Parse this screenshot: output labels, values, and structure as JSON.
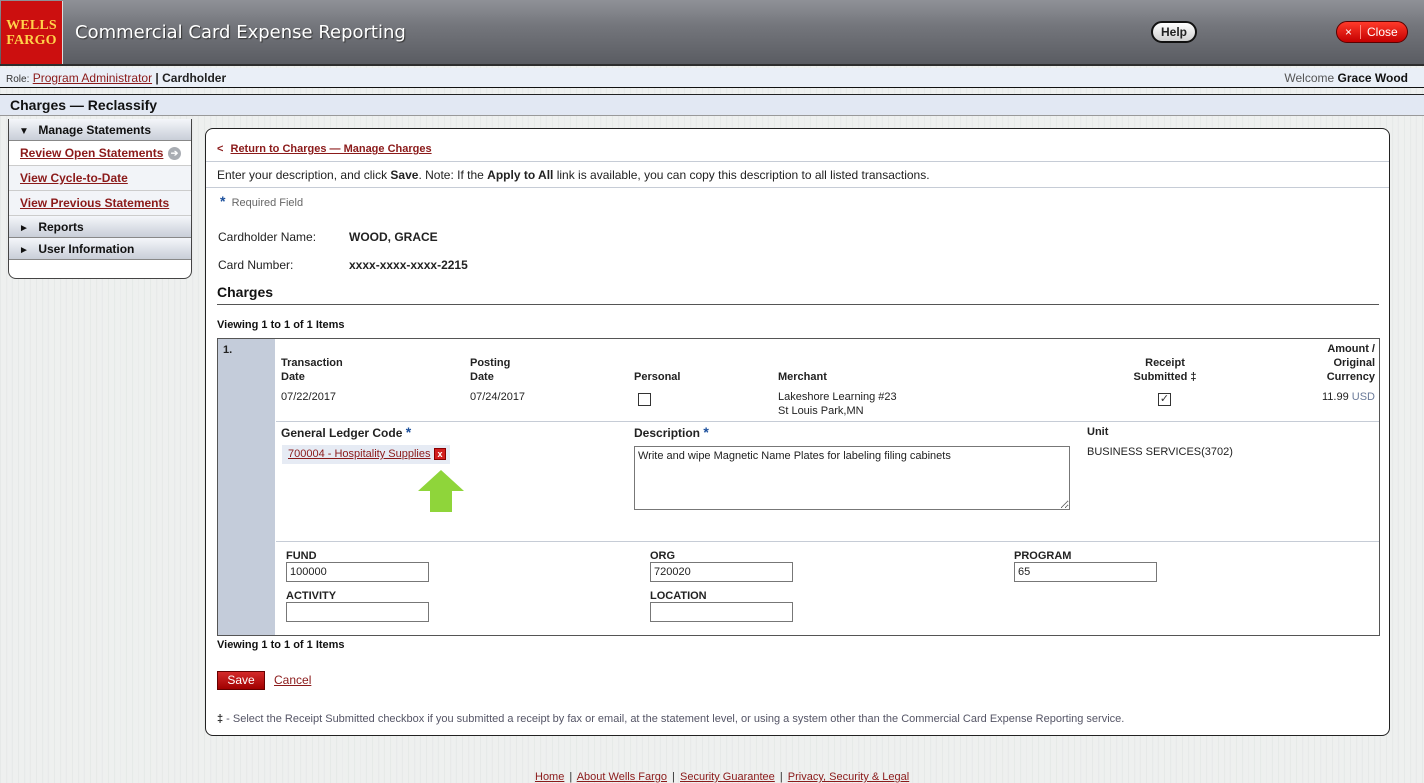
{
  "header": {
    "logo_line1": "WELLS",
    "logo_line2": "FARGO",
    "app_title": "Commercial Card Expense Reporting",
    "help_label": "Help",
    "close_icon": "×",
    "close_label": "Close"
  },
  "rolebar": {
    "role_prefix": "Role:",
    "role_link": "Program Administrator",
    "separator": "|",
    "current_role": "Cardholder",
    "welcome_prefix": "Welcome",
    "user_name": "Grace Wood"
  },
  "page_title": "Charges — Reclassify",
  "sidebar": {
    "sections": [
      {
        "arrow": "▼",
        "label": "Manage Statements"
      },
      {
        "arrow": "►",
        "label": "Reports"
      },
      {
        "arrow": "►",
        "label": "User Information"
      }
    ],
    "items": [
      {
        "label": "Review Open Statements",
        "icon": "➔"
      },
      {
        "label": "View Cycle-to-Date"
      },
      {
        "label": "View Previous Statements"
      }
    ]
  },
  "main": {
    "return_arrow": "<",
    "return_link": "Return to Charges — Manage Charges",
    "intro": {
      "part1": "Enter your description, and click ",
      "save": "Save",
      "part2": ". Note: If the ",
      "apply": "Apply to All",
      "part3": " link is available, you can copy this description to all listed transactions."
    },
    "required_star": "*",
    "required_label": "Required Field",
    "cardholder_label": "Cardholder Name:",
    "cardholder_value": "WOOD, GRACE",
    "card_number_label": "Card Number:",
    "card_number_value": "xxxx-xxxx-xxxx-2215",
    "section_title": "Charges",
    "viewing_top": "Viewing 1 to 1 of 1 Items",
    "viewing_bottom": "Viewing 1 to 1 of 1 Items",
    "charge": {
      "row_number": "1.",
      "headers": {
        "transaction_date_1": "Transaction",
        "transaction_date_2": "Date",
        "posting_date_1": "Posting",
        "posting_date_2": "Date",
        "personal": "Personal",
        "merchant": "Merchant",
        "receipt_1": "Receipt",
        "receipt_2": "Submitted ‡",
        "amount_1": "Amount /",
        "amount_2": "Original",
        "amount_3": "Currency"
      },
      "transaction_date": "07/22/2017",
      "posting_date": "07/24/2017",
      "personal_checked": false,
      "merchant_line1": "Lakeshore Learning #23",
      "merchant_line2": "St Louis Park,MN",
      "receipt_submitted": true,
      "receipt_check": "✓",
      "amount": "11.99",
      "currency": "USD",
      "gl_label": "General Ledger Code",
      "gl_value": "700004 - Hospitality Supplies",
      "gl_remove_icon": "x",
      "description_label": "Description",
      "description_value": "Write and wipe Magnetic Name Plates for labeling filing cabinets",
      "unit_label": "Unit",
      "unit_value": "BUSINESS SERVICES(3702)",
      "segments": {
        "fund_label": "FUND",
        "fund_value": "100000",
        "org_label": "ORG",
        "org_value": "720020",
        "program_label": "PROGRAM",
        "program_value": "65",
        "activity_label": "ACTIVITY",
        "activity_value": "",
        "location_label": "LOCATION",
        "location_value": ""
      }
    },
    "save_label": "Save",
    "cancel_label": "Cancel",
    "footnote_mark": "‡",
    "footnote_text": " - Select the Receipt Submitted checkbox if you submitted a receipt by fax or email, at the statement level, or using a system other than the Commercial Card Expense Reporting service."
  },
  "footer": {
    "links": [
      "Home",
      "About Wells Fargo",
      "Security Guarantee",
      "Privacy, Security & Legal"
    ],
    "separator": "|"
  },
  "colors": {
    "brand_red": "#cc0f0f",
    "link_red": "#8b1a1a",
    "required_blue": "#1b4f9c",
    "highlight_arrow": "#8fd53a"
  }
}
